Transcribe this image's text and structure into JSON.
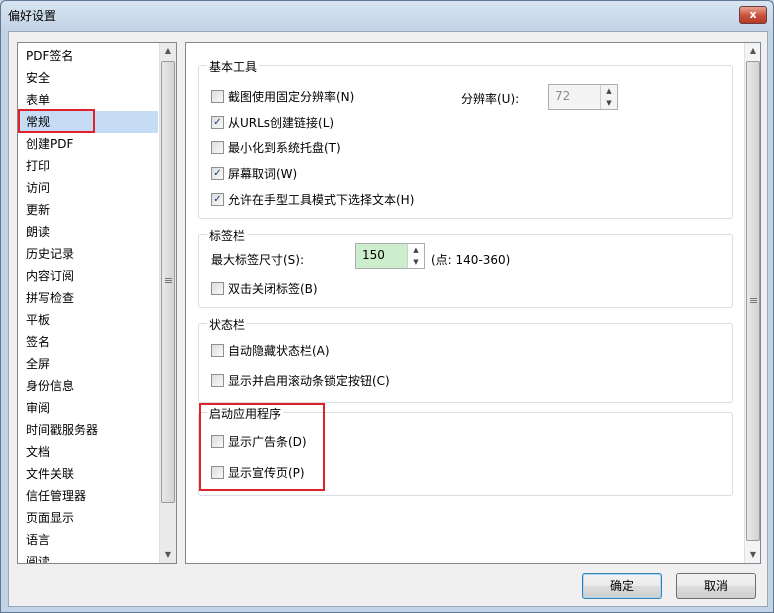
{
  "window": {
    "title": "偏好设置",
    "close_label": "x"
  },
  "nav": {
    "items": [
      {
        "label": "PDF签名"
      },
      {
        "label": "安全"
      },
      {
        "label": "表单"
      },
      {
        "label": "常规"
      },
      {
        "label": "创建PDF"
      },
      {
        "label": "打印"
      },
      {
        "label": "访问"
      },
      {
        "label": "更新"
      },
      {
        "label": "朗读"
      },
      {
        "label": "历史记录"
      },
      {
        "label": "内容订阅"
      },
      {
        "label": "拼写检查"
      },
      {
        "label": "平板"
      },
      {
        "label": "签名"
      },
      {
        "label": "全屏"
      },
      {
        "label": "身份信息"
      },
      {
        "label": "审阅"
      },
      {
        "label": "时间戳服务器"
      },
      {
        "label": "文档"
      },
      {
        "label": "文件关联"
      },
      {
        "label": "信任管理器"
      },
      {
        "label": "页面显示"
      },
      {
        "label": "语言"
      },
      {
        "label": "阅读"
      }
    ],
    "selected": "常规"
  },
  "basic_tools": {
    "title": "基本工具",
    "options": [
      {
        "label": "截图使用固定分辨率(N)",
        "checked": false
      },
      {
        "label": "从URLs创建链接(L)",
        "checked": true
      },
      {
        "label": "最小化到系统托盘(T)",
        "checked": false
      },
      {
        "label": "屏幕取词(W)",
        "checked": true
      },
      {
        "label": "允许在手型工具模式下选择文本(H)",
        "checked": true
      }
    ],
    "resolution_label": "分辨率(U):",
    "resolution_value": "72"
  },
  "tab_bar": {
    "title": "标签栏",
    "max_size_label": "最大标签尺寸(S):",
    "max_size_value": "150",
    "range_hint": "(点: 140-360)",
    "double_click_close": {
      "label": "双击关闭标签(B)",
      "checked": false
    }
  },
  "status_bar": {
    "title": "状态栏",
    "options": [
      {
        "label": "自动隐藏状态栏(A)",
        "checked": false
      },
      {
        "label": "显示并启用滚动条锁定按钮(C)",
        "checked": false
      }
    ]
  },
  "startup": {
    "title": "启动应用程序",
    "options": [
      {
        "label": "显示广告条(D)",
        "checked": false
      },
      {
        "label": "显示宣传页(P)",
        "checked": false
      }
    ]
  },
  "footer": {
    "ok_label": "确定",
    "cancel_label": "取消"
  },
  "colors": {
    "highlight": "#e0202a",
    "selected_bg": "#c6dcf5",
    "spin_active": "#cdeecd"
  }
}
